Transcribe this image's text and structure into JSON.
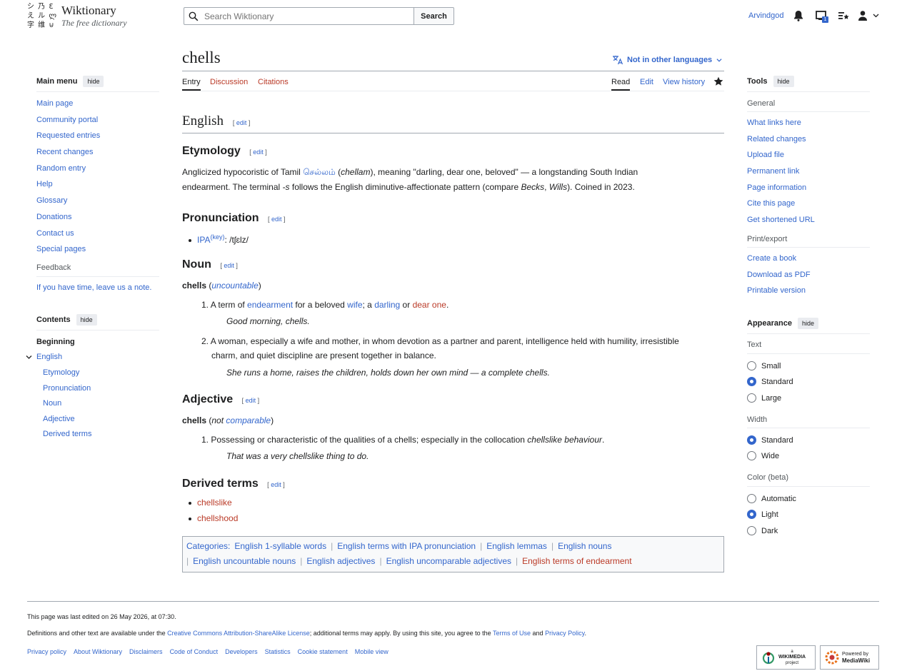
{
  "site": {
    "name": "Wiktionary",
    "tagline": "The free dictionary",
    "logo_glyphs": "シ 乃 Ɛ\nえ ル ლ\n字 维 ⊍"
  },
  "header": {
    "search_placeholder": "Search Wiktionary",
    "search_button": "Search",
    "username": "Arvindgod",
    "notice_count": "1"
  },
  "page": {
    "title": "chells",
    "languages_label": "Not in other languages",
    "tabs_left": [
      "Entry",
      "Discussion",
      "Citations"
    ],
    "tabs_right": [
      "Read",
      "Edit",
      "View history"
    ]
  },
  "main_menu": {
    "title": "Main menu",
    "hide": "hide",
    "items": [
      "Main page",
      "Community portal",
      "Requested entries",
      "Recent changes",
      "Random entry",
      "Help",
      "Glossary",
      "Donations",
      "Contact us",
      "Special pages"
    ],
    "feedback_heading": "Feedback",
    "feedback_link": "If you have time, leave us a note."
  },
  "contents": {
    "title": "Contents",
    "hide": "hide",
    "beginning": "Beginning",
    "top": "English",
    "subs": [
      "Etymology",
      "Pronunciation",
      "Noun",
      "Adjective",
      "Derived terms"
    ]
  },
  "article": {
    "edit": "edit",
    "lang_heading": "English",
    "etym": {
      "heading": "Etymology",
      "t1": "Anglicized hypocoristic of Tamil ",
      "tamil": "செல்லம்",
      "t2": " (",
      "translit": "chellam",
      "t3": "), meaning \"darling, dear one, beloved\" — a longstanding South Indian",
      "t4": "endearment. The terminal ",
      "suffix": "-s",
      "t5": " follows the English diminutive-affectionate pattern (compare ",
      "ex1": "Becks",
      "t6": ", ",
      "ex2": "Wills",
      "t7": "). Coined in 2023."
    },
    "pron": {
      "heading": "Pronunciation",
      "ipa_label": "IPA",
      "key": "(key)",
      "ipa": ": /tʃɛlz/"
    },
    "noun": {
      "heading": "Noun",
      "headword": "chells",
      "gram": "uncountable",
      "def1": {
        "num": "1.",
        "a": "A term of ",
        "l1": "endearment",
        "b": " for a beloved ",
        "l2": "wife",
        "c": "; a ",
        "l3": "darling",
        "d": " or ",
        "l4": "dear one",
        "e": ".",
        "example": "Good morning, chells."
      },
      "def2": {
        "num": "2.",
        "line1": "A woman, especially a wife and mother, in whom devotion as a partner and parent, intelligence held with humility, irresistible",
        "line2": "charm, and quiet discipline are present together in balance.",
        "example": "She runs a home, raises the children, holds down her own mind — a complete chells."
      }
    },
    "adj": {
      "heading": "Adjective",
      "headword": "chells",
      "not": "not",
      "gram": "comparable",
      "def1": {
        "num": "1.",
        "a": "Possessing or characteristic of the qualities of a chells; especially in the collocation ",
        "term": "chellslike behaviour",
        "b": ".",
        "example": "That was a very chellslike thing to do."
      }
    },
    "derived": {
      "heading": "Derived terms",
      "items": [
        "chellslike",
        "chellshood"
      ]
    },
    "categories": {
      "label": "Categories:",
      "row1": [
        "English 1-syllable words",
        "English terms with IPA pronunciation",
        "English lemmas",
        "English nouns"
      ],
      "row2": [
        "English uncountable nouns",
        "English adjectives",
        "English uncomparable adjectives",
        "English terms of endearment"
      ]
    }
  },
  "tools": {
    "title": "Tools",
    "hide": "hide",
    "general_heading": "General",
    "general": [
      "What links here",
      "Related changes",
      "Upload file",
      "Permanent link",
      "Page information",
      "Cite this page",
      "Get shortened URL"
    ],
    "print_heading": "Print/export",
    "print": [
      "Create a book",
      "Download as PDF",
      "Printable version"
    ]
  },
  "appearance": {
    "title": "Appearance",
    "hide": "hide",
    "text_heading": "Text",
    "text_options": [
      "Small",
      "Standard",
      "Large"
    ],
    "text_selected": "Standard",
    "width_heading": "Width",
    "width_options": [
      "Standard",
      "Wide"
    ],
    "width_selected": "Standard",
    "color_heading": "Color (beta)",
    "color_options": [
      "Automatic",
      "Light",
      "Dark"
    ],
    "color_selected": "Light"
  },
  "footer": {
    "edited": "This page was last edited on 26 May 2026, at 07:30.",
    "license_a": "Definitions and other text are available under the ",
    "license_link": "Creative Commons Attribution-ShareAlike License",
    "license_b": "; additional terms may apply. By using this site, you agree to the ",
    "terms": "Terms of Use",
    "license_c": " and ",
    "privacy": "Privacy Policy",
    "license_d": ".",
    "links": [
      "Privacy policy",
      "About Wiktionary",
      "Disclaimers",
      "Code of Conduct",
      "Developers",
      "Statistics",
      "Cookie statement",
      "Mobile view"
    ],
    "wikimedia_small": "a",
    "wikimedia_big": "WIKIMEDIA",
    "wikimedia_sub": "project",
    "mediawiki_small": "Powered by",
    "mediawiki_big": "MediaWiki"
  }
}
